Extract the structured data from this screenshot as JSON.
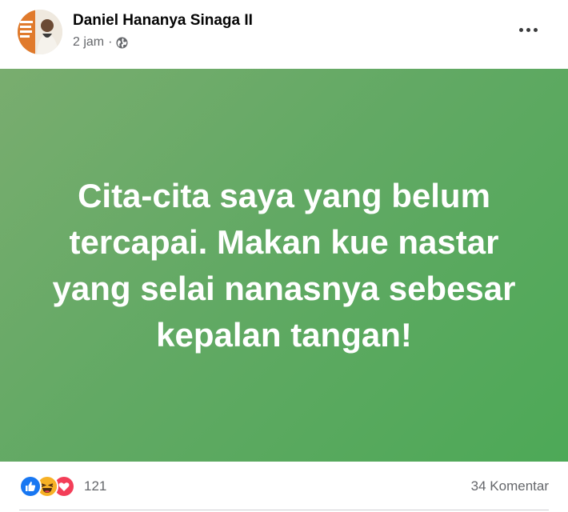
{
  "post": {
    "author": "Daniel Hananya Sinaga II",
    "time": "2 jam",
    "separator": "·",
    "privacy_icon": "globe-icon",
    "more_icon": "more-options-icon",
    "text": "Cita-cita saya yang belum tercapai. Makan kue nastar yang selai nanasnya sebesar kepalan tangan!",
    "background_colors": [
      "#79ad6f",
      "#4da957"
    ]
  },
  "reactions": {
    "icons": [
      "like-reaction-icon",
      "haha-reaction-icon",
      "love-reaction-icon"
    ],
    "count": "121"
  },
  "comments": {
    "label": "34 Komentar"
  },
  "colors": {
    "like": "#1877f2",
    "love": "#f33e58",
    "haha": "#f7b125",
    "secondary_text": "#65676b"
  }
}
